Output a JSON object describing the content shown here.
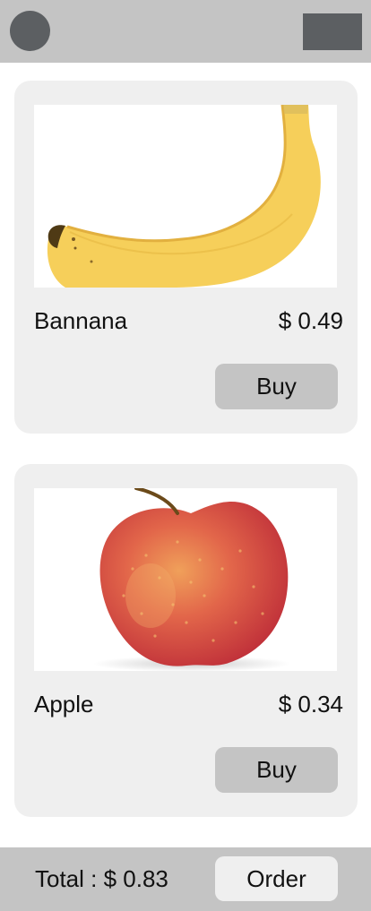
{
  "header": {
    "avatar_icon": "avatar-icon",
    "menu_icon": "menu-icon",
    "bar_color": "#c4c4c4",
    "icon_color": "#5c5f62"
  },
  "products": [
    {
      "image_icon": "banana-image",
      "name": "Bannana",
      "price": "$ 0.49",
      "buy_label": "Buy"
    },
    {
      "image_icon": "apple-image",
      "name": "Apple",
      "price": "$ 0.34",
      "buy_label": "Buy"
    }
  ],
  "footer": {
    "total_label": "Total : $ 0.83",
    "order_label": "Order"
  },
  "colors": {
    "card_background": "#efefef",
    "button_background": "#c4c4c4"
  }
}
